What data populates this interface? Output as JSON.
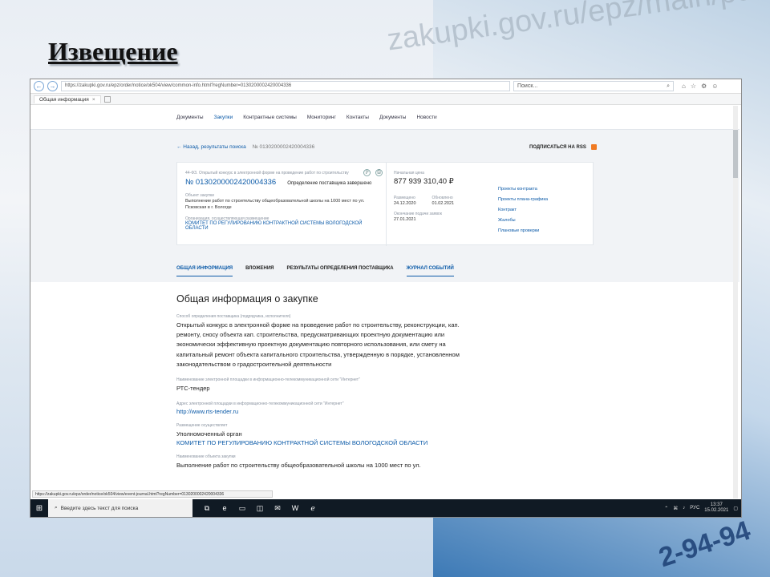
{
  "slide": {
    "title": "Извещение",
    "background_url": "zakupki.gov.ru/epz/main/public/home.htm",
    "background_phone": "2-94-94"
  },
  "browser": {
    "address": "https://zakupki.gov.ru/epz/order/notice/ok504/view/common-info.html?regNumber=0130200002420004336",
    "search_placeholder": "Поиск...",
    "tab_label": "Общая информация",
    "tab_close": "×"
  },
  "site": {
    "nav": [
      "Документы",
      "Закупки",
      "Контрактные системы",
      "Мониторинг",
      "Контакты",
      "Документы",
      "Новости"
    ],
    "crumb_back": "← Назад, результаты поиска",
    "crumb_number": "№ 0130200002420004336",
    "rss": "ПОДПИСАТЬСЯ НА RSS",
    "card": {
      "law_line": "44-ФЗ. Открытый конкурс в электронной форме на проведение работ по строительству",
      "number": "№ 0130200002420004336",
      "stage": "Определение поставщика завершено",
      "object_label": "Объект закупки",
      "object_value": "Выполнение работ по строительству общеобразовательной школы на 1000 мест по ул. Псковская в г. Вологде",
      "org_label": "Организация, осуществляющая размещение",
      "org_value": "КОМИТЕТ ПО РЕГУЛИРОВАНИЮ КОНТРАКТНОЙ СИСТЕМЫ ВОЛОГОДСКОЙ ОБЛАСТИ",
      "price_label": "Начальная цена",
      "price": "877 939 310,40 ₽",
      "posted_label": "Размещено",
      "posted": "24.12.2020",
      "updated_label": "Обновлено",
      "updated": "01.02.2021",
      "end_label": "Окончание подачи заявок",
      "end": "27.01.2021",
      "links": [
        "Проекты контракта",
        "Проекты плана-графика",
        "Контракт",
        "Жалобы",
        "Плановые проверки"
      ]
    },
    "tabs": [
      "ОБЩАЯ ИНФОРМАЦИЯ",
      "ВЛОЖЕНИЯ",
      "РЕЗУЛЬТАТЫ ОПРЕДЕЛЕНИЯ ПОСТАВЩИКА",
      "ЖУРНАЛ СОБЫТИЙ"
    ],
    "section_title": "Общая информация о закупке",
    "fields": {
      "method_label": "Способ определения поставщика (подрядчика, исполнителя)",
      "method_value": "Открытый конкурс в электронной форме на проведение работ по строительству, реконструкции, кап. ремонту, сносу объекта кап. строительства, предусматривающих проектную документацию или экономически эффективную проектную документацию повторного использования, или смету на капитальный ремонт объекта капитального строительства, утвержденную в порядке, установленном законодательством о градостроительной деятельности",
      "platform_label": "Наименование электронной площадки в информационно-телекоммуникационной сети \"Интернет\"",
      "platform_value": "РТС-тендер",
      "address_label": "Адрес электронной площадки в информационно-телекоммуникационной сети \"Интернет\"",
      "address_value": "http://www.rts-tender.ru",
      "placer_label": "Размещение осуществляет",
      "placer_value": "Уполномоченный орган",
      "placer_org": "КОМИТЕТ ПО РЕГУЛИРОВАНИЮ КОНТРАКТНОЙ СИСТЕМЫ ВОЛОГОДСКОЙ ОБЛАСТИ",
      "object_label": "Наименование объекта закупки",
      "object_value": "Выполнение работ по строительству общеобразовательной школы на 1000 мест по ул."
    },
    "status_url": "https://zakupki.gov.ru/epz/order/notice/ok504/view/event-journal.html?regNumber=0130200002420004336"
  },
  "taskbar": {
    "search_placeholder": "Введите здесь текст для поиска",
    "tray_lang": "РУС",
    "time": "13:37",
    "date": "15.02.2021"
  },
  "colors": {
    "accent": "#0b5aa8",
    "taskbar": "#101a24",
    "rss": "#f07a22"
  }
}
